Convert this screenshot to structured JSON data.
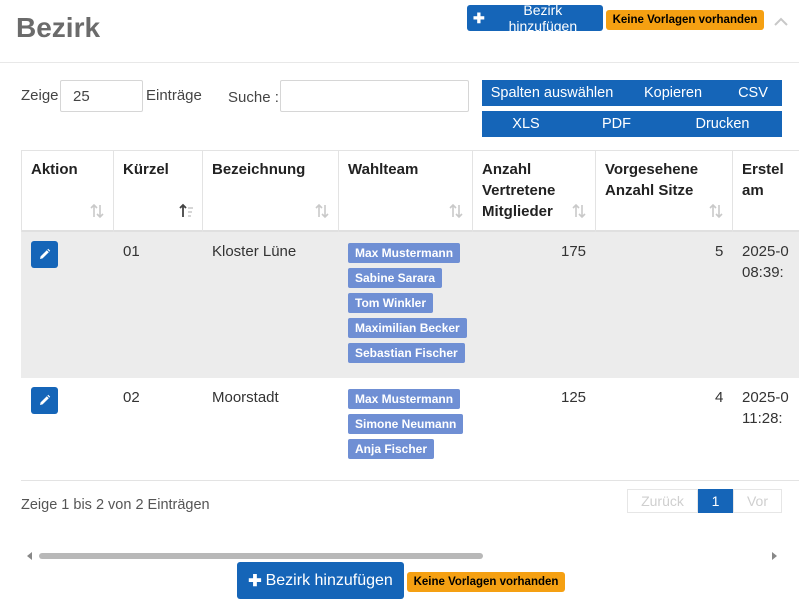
{
  "page": {
    "title": "Bezirk",
    "add_button_label": "Bezirk hinzufügen",
    "no_templates_label": "Keine Vorlagen vorhanden"
  },
  "controls": {
    "show_label": "Zeige",
    "entries_value": "25",
    "entries_label": "Einträge",
    "search_label": "Suche :",
    "search_value": ""
  },
  "export_buttons": {
    "row1": [
      "Spalten auswählen",
      "Kopieren",
      "CSV"
    ],
    "row2": [
      "XLS",
      "PDF",
      "Drucken"
    ]
  },
  "table": {
    "headers": [
      "Aktion",
      "Kürzel",
      "Bezeichnung",
      "Wahlteam",
      "Anzahl Vertretene Mitglieder",
      "Vorgesehene Anzahl Sitze",
      "Erstel am"
    ],
    "header_lines": {
      "anzahl": [
        "Anzahl",
        "Vertretene",
        "Mitglieder"
      ],
      "vorgesehene": [
        "Vorgesehene",
        "Anzahl Sitze"
      ],
      "erstellt": [
        "Erstel",
        "am"
      ]
    },
    "rows": [
      {
        "kuerzel": "01",
        "bezeichnung": "Kloster Lüne",
        "wahlteam": [
          "Max Mustermann",
          "Sabine Sarara",
          "Tom Winkler",
          "Maximilian Becker",
          "Sebastian Fischer"
        ],
        "anzahl": "175",
        "sitze": "5",
        "erstellt_date": "2025-0",
        "erstellt_time": "08:39:"
      },
      {
        "kuerzel": "02",
        "bezeichnung": "Moorstadt",
        "wahlteam": [
          "Max Mustermann",
          "Simone Neumann",
          "Anja Fischer"
        ],
        "anzahl": "125",
        "sitze": "4",
        "erstellt_date": "2025-0",
        "erstellt_time": "11:28:"
      }
    ]
  },
  "footer": {
    "info": "Zeige 1 bis 2 von 2 Einträgen",
    "prev": "Zurück",
    "page": "1",
    "next": "Vor"
  },
  "colors": {
    "primary": "#1565b8",
    "warning": "#f5a012",
    "tag": "#6f8fd4",
    "row_highlight": "#ececec"
  },
  "icons": {
    "plus": "plus-icon",
    "collapse": "chevron-up-icon",
    "edit": "pencil-icon",
    "sort": "sort-icon",
    "sort_asc": "sort-asc-icon"
  }
}
